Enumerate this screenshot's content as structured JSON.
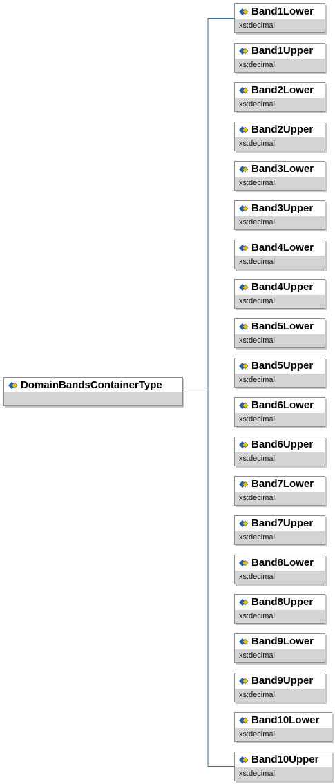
{
  "root": {
    "name": "DomainBandsContainerType",
    "icon": "complex-type-icon"
  },
  "children": [
    {
      "name": "Band1Lower",
      "type": "xs:decimal",
      "icon": "element-icon"
    },
    {
      "name": "Band1Upper",
      "type": "xs:decimal",
      "icon": "element-icon"
    },
    {
      "name": "Band2Lower",
      "type": "xs:decimal",
      "icon": "element-icon"
    },
    {
      "name": "Band2Upper",
      "type": "xs:decimal",
      "icon": "element-icon"
    },
    {
      "name": "Band3Lower",
      "type": "xs:decimal",
      "icon": "element-icon"
    },
    {
      "name": "Band3Upper",
      "type": "xs:decimal",
      "icon": "element-icon"
    },
    {
      "name": "Band4Lower",
      "type": "xs:decimal",
      "icon": "element-icon"
    },
    {
      "name": "Band4Upper",
      "type": "xs:decimal",
      "icon": "element-icon"
    },
    {
      "name": "Band5Lower",
      "type": "xs:decimal",
      "icon": "element-icon"
    },
    {
      "name": "Band5Upper",
      "type": "xs:decimal",
      "icon": "element-icon"
    },
    {
      "name": "Band6Lower",
      "type": "xs:decimal",
      "icon": "element-icon"
    },
    {
      "name": "Band6Upper",
      "type": "xs:decimal",
      "icon": "element-icon"
    },
    {
      "name": "Band7Lower",
      "type": "xs:decimal",
      "icon": "element-icon"
    },
    {
      "name": "Band7Upper",
      "type": "xs:decimal",
      "icon": "element-icon"
    },
    {
      "name": "Band8Lower",
      "type": "xs:decimal",
      "icon": "element-icon"
    },
    {
      "name": "Band8Upper",
      "type": "xs:decimal",
      "icon": "element-icon"
    },
    {
      "name": "Band9Lower",
      "type": "xs:decimal",
      "icon": "element-icon"
    },
    {
      "name": "Band9Upper",
      "type": "xs:decimal",
      "icon": "element-icon"
    },
    {
      "name": "Band10Lower",
      "type": "xs:decimal",
      "icon": "element-icon"
    },
    {
      "name": "Band10Upper",
      "type": "xs:decimal",
      "icon": "element-icon"
    }
  ],
  "colors": {
    "connector": "#3d6f8f",
    "border": "#8c8c8c",
    "type_band": "#d4d4d4",
    "icon_blue": "#1e5ea8",
    "icon_yellow": "#f2c200"
  }
}
